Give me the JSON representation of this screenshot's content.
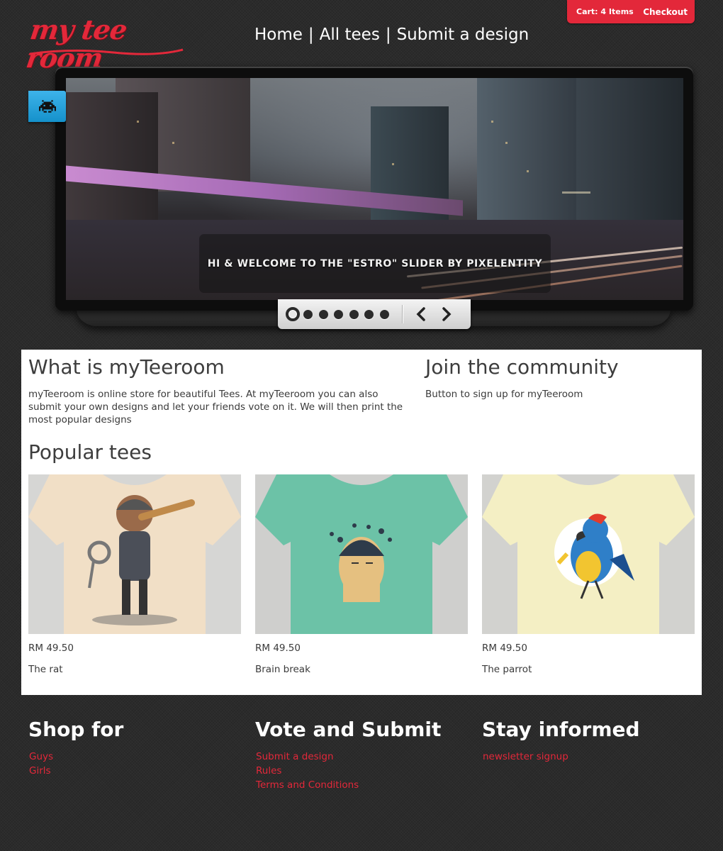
{
  "header": {
    "logo_text": "my tee room",
    "nav": [
      {
        "label": "Home"
      },
      {
        "label": "All tees"
      },
      {
        "label": "Submit a design"
      }
    ],
    "nav_separator": "|",
    "cart_label": "Cart: 4 Items",
    "checkout_label": "Checkout"
  },
  "slider": {
    "caption": "HI & WELCOME TO THE \"ESTRO\" SLIDER BY PIXELENTITY",
    "dot_count": 7,
    "active_dot": 1,
    "ribbon_icon": "space-invader-icon"
  },
  "about": {
    "title": "What is myTeeroom",
    "text": "myTeeroom is online store for beautiful Tees. At myTeeroom you can also submit your own designs and let your friends vote on it. We will then print the most popular designs"
  },
  "community": {
    "title": "Join the community",
    "text": "Button to sign up for myTeeroom"
  },
  "popular": {
    "title": "Popular tees",
    "items": [
      {
        "price": "RM 49.50",
        "name": "The rat",
        "shirt_color": "#f1dfc6",
        "bg_color": "#d6d6d4"
      },
      {
        "price": "RM 49.50",
        "name": "Brain break",
        "shirt_color": "#6cc2a7",
        "bg_color": "#cfcfcd"
      },
      {
        "price": "RM 49.50",
        "name": "The parrot",
        "shirt_color": "#f4efc4",
        "bg_color": "#d2d2cf"
      }
    ]
  },
  "footer": {
    "shop": {
      "title": "Shop for",
      "links": [
        "Guys",
        "Girls"
      ]
    },
    "vote": {
      "title": "Vote and Submit",
      "links": [
        "Submit a design",
        "Rules",
        "Terms and Conditions"
      ]
    },
    "informed": {
      "title": "Stay informed",
      "links": [
        "newsletter signup"
      ]
    }
  },
  "colors": {
    "accent": "#e3283a",
    "background": "#2b2b2b",
    "ribbon": "#2aa5df"
  }
}
